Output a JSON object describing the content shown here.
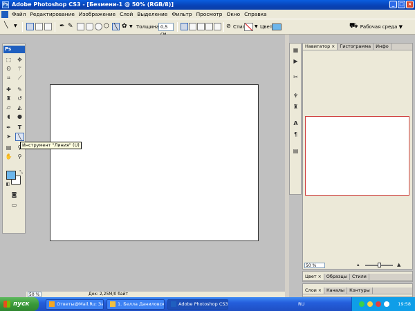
{
  "window": {
    "title": "Adobe Photoshop CS3 - [Безмени-1 @ 50% (RGB/8)]",
    "app_icon": "Ps"
  },
  "menu": {
    "items": [
      "Файл",
      "Редактирование",
      "Изображение",
      "Слой",
      "Выделение",
      "Фильтр",
      "Просмотр",
      "Окно",
      "Справка"
    ]
  },
  "options": {
    "thickness_label": "Толщина:",
    "thickness_value": "0,5 см",
    "style_label": "Стиль:",
    "color_label": "Цвет:",
    "color_value": "#6cb6ec",
    "workspace_label": "Рабочая среда ▼"
  },
  "toolbox": {
    "logo": "Ps",
    "tooltip": "Инструмент \"Линия\" (U)",
    "fg_color": "#6cb6ec",
    "bg_color": "#ffffff"
  },
  "document": {
    "zoom": "50 %",
    "info": "Док: 2,25M/0 байт"
  },
  "navigator": {
    "tabs": [
      "Навигатор",
      "Гистограмма",
      "Инфо"
    ],
    "zoom": "50 %"
  },
  "color_panel": {
    "tabs": [
      "Цвет",
      "Образцы",
      "Стили"
    ]
  },
  "layers_panel": {
    "tabs": [
      "Слои",
      "Каналы",
      "Контуры"
    ]
  },
  "taskbar": {
    "start_label": "пуск",
    "tasks": [
      "Ответы@Mail.Ru: За...",
      "1. Белла Даниловск...",
      "Adobe Photoshop CS3"
    ],
    "language": "RU",
    "clock": "19:58"
  }
}
